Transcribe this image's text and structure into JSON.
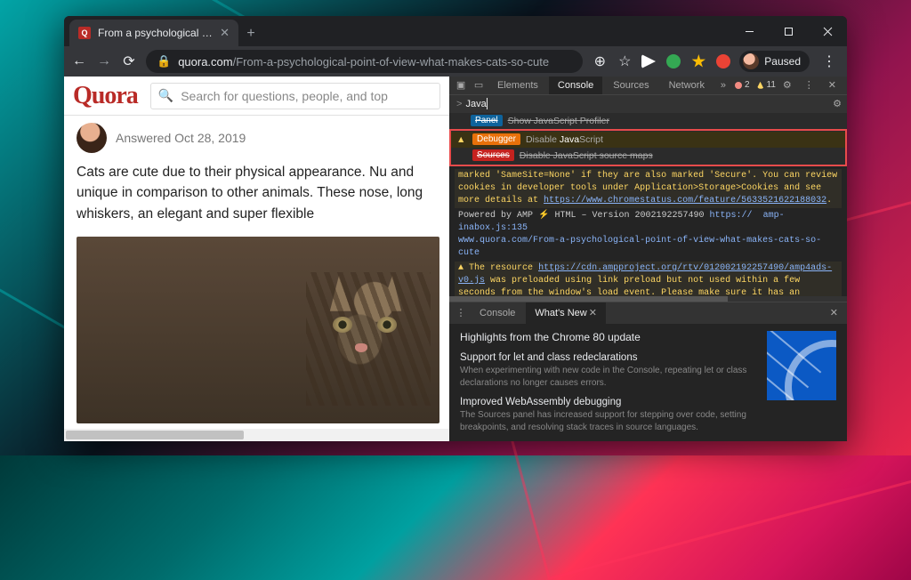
{
  "window": {
    "tab_title": "From a psychological point of vi",
    "minimize": "—",
    "maximize": "▭",
    "close": "✕"
  },
  "addressbar": {
    "domain": "quora.com",
    "path": "/From-a-psychological-point-of-view-what-makes-cats-so-cute",
    "profile_label": "Paused"
  },
  "page": {
    "logo": "Quora",
    "search_placeholder": "Search for questions, people, and top",
    "answered_label": "Answered Oct 28, 2019",
    "answer_body": "Cats are cute due to their physical appearance. Nu and unique in comparison to other animals. These nose, long whiskers, an elegant and super flexible "
  },
  "devtools": {
    "tabs": [
      "Elements",
      "Console",
      "Sources",
      "Network"
    ],
    "active_tab": "Console",
    "more": "»",
    "errors": 2,
    "warnings": 11,
    "cmd_prefix": ">",
    "cmd_query": "Java",
    "dropdown": [
      {
        "chip": "Panel",
        "chip_cls": "panel",
        "text": "Show JavaScript Profiler",
        "strike": true,
        "warn": false
      },
      {
        "chip": "Debugger",
        "chip_cls": "debugger",
        "text": "Disable JavaScript",
        "strike": false,
        "warn": true,
        "hl": "Java"
      },
      {
        "chip": "Sources",
        "chip_cls": "sources",
        "text": "Disable JavaScript source maps",
        "strike": true,
        "warn": false
      }
    ],
    "log1": "marked 'SameSite=None' if they are also marked 'Secure'. You can review cookies in developer tools under Application>Storage>Cookies and see more details at ",
    "log1_link": "https://www.chromestatus.com/feature/5633521622188032",
    "log2a": "Powered by AMP ⚡ HTML – Version 2002192257490 ",
    "log2_link1": "https://",
    "log2b": " ",
    "log2_link2": "amp-inabox.js:135",
    "log2_link3": "www.quora.com/From-a-psychological-point-of-view-what-makes-cats-so-cute",
    "log3a": "The resource ",
    "log3_link": "https://cdn.ampproject.org/rtv/012002192257490/amp4ads-v0.js",
    "log3b": " was preloaded using link preload but not used within a few seconds from the window's load event. Please make sure it has an appropriate `as` value and it is preloaded intentionally.",
    "prompt": "›"
  },
  "drawer": {
    "tabs": [
      "Console",
      "What's New"
    ],
    "active_tab": "What's New",
    "headline": "Highlights from the Chrome 80 update",
    "item1_title": "Support for let and class redeclarations",
    "item1_body": "When experimenting with new code in the Console, repeating let or class declarations no longer causes errors.",
    "item2_title": "Improved WebAssembly debugging",
    "item2_body": "The Sources panel has increased support for stepping over code, setting breakpoints, and resolving stack traces in source languages."
  }
}
